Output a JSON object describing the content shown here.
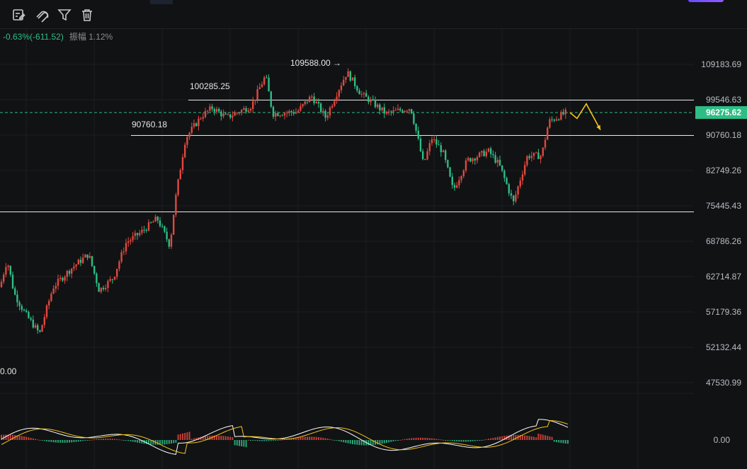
{
  "toolbar": {
    "icons": [
      "edit-icon",
      "magnet-icon",
      "filter-icon",
      "trash-icon"
    ]
  },
  "stats": {
    "change": "-0.63%(-611.52)",
    "amplitude_label": "振幅",
    "amplitude_value": "1.12%"
  },
  "colors": {
    "up": "#e0483f",
    "down": "#2ebd85",
    "accent": "#2ebd85",
    "arrow": "#f5c518",
    "macd_line": "#ffffff",
    "signal_line": "#f0c419"
  },
  "chart_data": {
    "type": "candlestick",
    "y_axis_ticks": [
      "109183.69",
      "99546.63",
      "90760.18",
      "82749.26",
      "75445.43",
      "68786.26",
      "62714.87",
      "57179.36",
      "52132.44",
      "47530.99"
    ],
    "y_axis_scale": "log",
    "current_price_label": "96275.62",
    "current_price": 96275.62,
    "annotations": [
      {
        "text": "109588.00",
        "value": 109588.0,
        "arrow": "→"
      },
      {
        "text": "100285.25",
        "value": 100285.25
      },
      {
        "text": "90760.18",
        "value": 90760.18
      },
      {
        "text": "0.00",
        "value": 0.0
      }
    ],
    "horizontal_lines": [
      99546.63,
      90760.18,
      74300
    ],
    "indicator": {
      "name": "MACD",
      "zero_label": "0.00"
    },
    "projection": [
      96275.62,
      94800,
      98500,
      92000
    ]
  }
}
